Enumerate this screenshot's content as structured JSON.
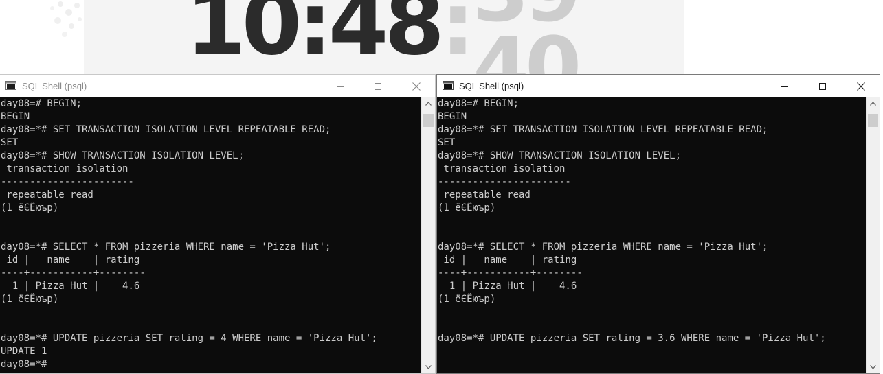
{
  "desktop": {
    "clock": {
      "hours_minutes": "10:48",
      "separator": ":",
      "seconds": "39"
    }
  },
  "left_window": {
    "title": "SQL Shell (psql)",
    "controls": {
      "minimize": "minimize",
      "maximize": "maximize",
      "close": "close"
    },
    "lines": [
      "day08=# BEGIN;",
      "BEGIN",
      "day08=*# SET TRANSACTION ISOLATION LEVEL REPEATABLE READ;",
      "SET",
      "day08=*# SHOW TRANSACTION ISOLATION LEVEL;",
      " transaction_isolation",
      "-----------------------",
      " repeatable read",
      "(1 ёЄЁюър)",
      "",
      "",
      "day08=*# SELECT * FROM pizzeria WHERE name = 'Pizza Hut';",
      " id |   name    | rating",
      "----+-----------+--------",
      "  1 | Pizza Hut |    4.6",
      "(1 ёЄЁюър)",
      "",
      "",
      "day08=*# UPDATE pizzeria SET rating = 4 WHERE name = 'Pizza Hut';",
      "UPDATE 1",
      "day08=*#"
    ]
  },
  "right_window": {
    "title": "SQL Shell (psql)",
    "controls": {
      "minimize": "minimize",
      "maximize": "maximize",
      "close": "close"
    },
    "lines": [
      "day08=# BEGIN;",
      "BEGIN",
      "day08=*# SET TRANSACTION ISOLATION LEVEL REPEATABLE READ;",
      "SET",
      "day08=*# SHOW TRANSACTION ISOLATION LEVEL;",
      " transaction_isolation",
      "-----------------------",
      " repeatable read",
      "(1 ёЄЁюър)",
      "",
      "",
      "day08=*# SELECT * FROM pizzeria WHERE name = 'Pizza Hut';",
      " id |   name    | rating",
      "----+-----------+--------",
      "  1 | Pizza Hut |    4.6",
      "(1 ёЄЁюър)",
      "",
      "",
      "day08=*# UPDATE pizzeria SET rating = 3.6 WHERE name = 'Pizza Hut';"
    ]
  },
  "colors": {
    "console_bg": "#0c0c0c",
    "console_text": "#cccccc",
    "titlebar_bg": "#ffffff",
    "scrollbar_bg": "#f0f0f0"
  }
}
